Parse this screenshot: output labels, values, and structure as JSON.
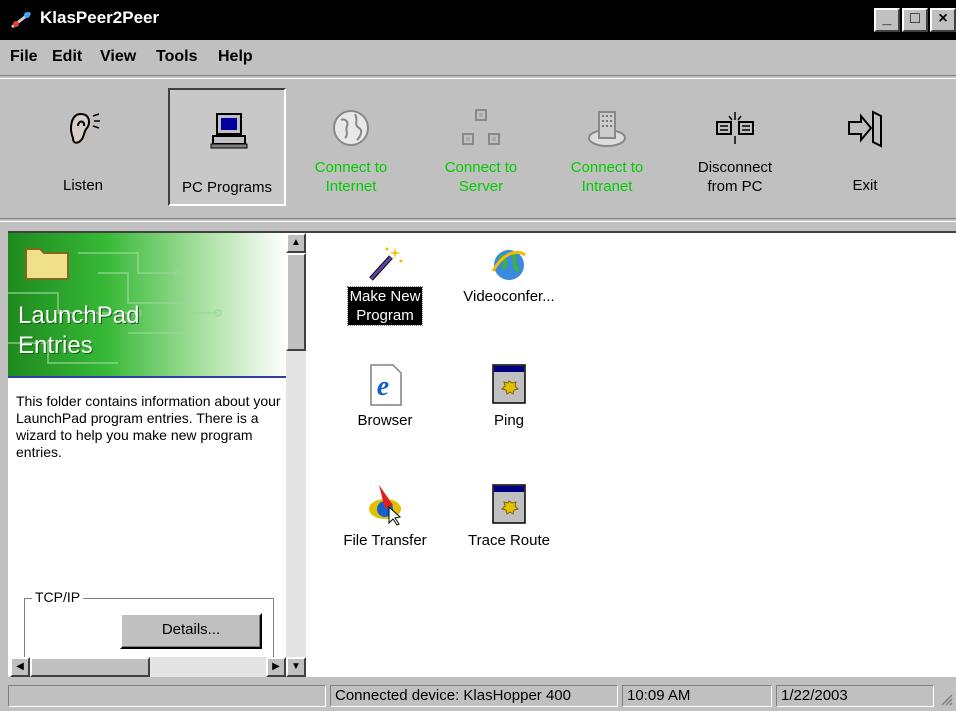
{
  "window": {
    "title": "KlasPeer2Peer"
  },
  "menu": [
    "File",
    "Edit",
    "View",
    "Tools",
    "Help"
  ],
  "toolbar": {
    "listen": "Listen",
    "pc_programs": "PC Programs",
    "connect_internet": [
      "Connect to",
      "Internet"
    ],
    "connect_server": [
      "Connect to",
      "Server"
    ],
    "connect_intranet": [
      "Connect to",
      "Intranet"
    ],
    "disconnect": [
      "Disconnect",
      "from PC"
    ],
    "exit": "Exit"
  },
  "left_pane": {
    "title": [
      "LaunchPad",
      "Entries"
    ],
    "description": "This folder contains information about your LaunchPad program entries. There is a wizard to help you make new program entries.",
    "group_label": "TCP/IP",
    "details_button": "Details..."
  },
  "icons": [
    {
      "name": "Make New Program",
      "icon": "wand-icon",
      "selected": true
    },
    {
      "name": "Videoconfer...",
      "icon": "globe-network-icon"
    },
    {
      "name": "Browser",
      "icon": "internet-explorer-icon"
    },
    {
      "name": "Ping",
      "icon": "program-window-icon"
    },
    {
      "name": "File Transfer",
      "icon": "file-transfer-icon"
    },
    {
      "name": "Trace Route",
      "icon": "program-window-icon"
    }
  ],
  "status": {
    "device": "Connected device: KlasHopper 400",
    "time": "10:09 AM",
    "date": "1/22/2003"
  }
}
